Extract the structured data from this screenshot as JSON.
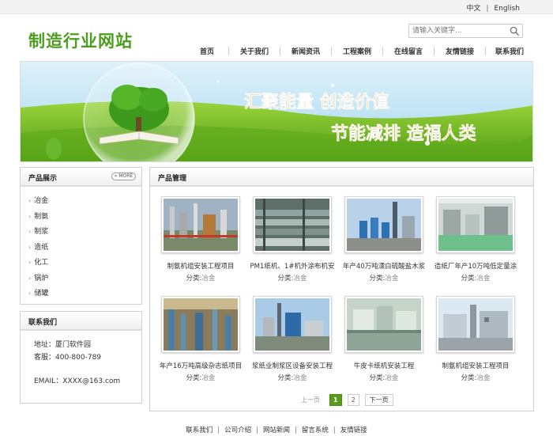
{
  "header": {
    "lang_zh": "中文",
    "lang_sep": "|",
    "lang_en": "English",
    "logo_text": "制造行业网站",
    "search_placeholder": "请输入关键字...",
    "nav": [
      "首页",
      "关于我们",
      "新闻资讯",
      "工程案例",
      "在线留言",
      "友情链接",
      "联系我们"
    ]
  },
  "banner": {
    "slogan_1": "汇聚能量 创造价值",
    "slogan_2": "节能减排 造福人类"
  },
  "sidebar": {
    "products_title": "产品展示",
    "more_label": "MORE",
    "categories": [
      "冶金",
      "制氨",
      "制浆",
      "造纸",
      "化工",
      "锅炉",
      "储罐"
    ],
    "contact_title": "联系我们",
    "address": "地址：厦门软件园",
    "service": "客服：400-800-789",
    "email": "EMAIL：XXXX@163.com"
  },
  "main": {
    "title": "产品管理",
    "class_prefix": "分类:",
    "products": [
      {
        "name": "制氨机组安装工程项目",
        "category": "冶金",
        "image": "industrial-plant-photo"
      },
      {
        "name": "PM1纸机、1#机外涂布机安",
        "category": "冶金",
        "image": "paper-machine-photo"
      },
      {
        "name": "年产40万吨漂白硫酸盐木浆",
        "category": "冶金",
        "image": "pulp-mill-towers-photo"
      },
      {
        "name": "造纸厂年产10万吨低定量涂",
        "category": "冶金",
        "image": "factory-hall-photo"
      },
      {
        "name": "年产16万吨高级杂志纸项目",
        "category": "冶金",
        "image": "pipe-hall-photo"
      },
      {
        "name": "浆纸业制浆区设备安装工程",
        "category": "冶金",
        "image": "plant-exterior-photo"
      },
      {
        "name": "牛皮卡纸机安装工程",
        "category": "冶金",
        "image": "machine-room-photo"
      },
      {
        "name": "制氨机组安装工程项目",
        "category": "冶金",
        "image": "plant-building-photo"
      }
    ],
    "pager": {
      "prev": "上一页",
      "pages": [
        "1",
        "2"
      ],
      "current": "1",
      "next": "下一页"
    }
  },
  "footer": {
    "links": [
      "联系我们",
      "公司介绍",
      "网站新闻",
      "留言系统",
      "友情链接"
    ],
    "sep": "|"
  },
  "colors": {
    "brand_green": "#4c9e1f",
    "slogan_orange": "#f39c2a",
    "pager_active": "#5a9b1a"
  }
}
